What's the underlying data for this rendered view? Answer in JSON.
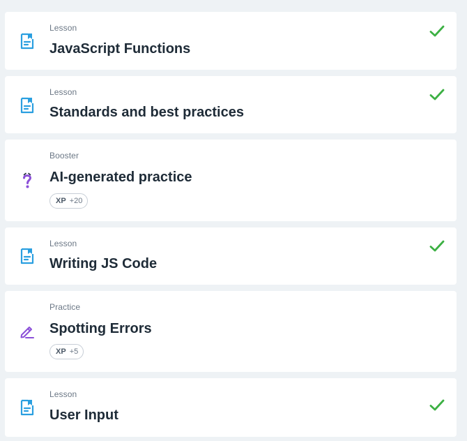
{
  "items": [
    {
      "type": "Lesson",
      "title": "JavaScript Functions",
      "icon": "lesson-icon",
      "completed": true
    },
    {
      "type": "Lesson",
      "title": "Standards and best practices",
      "icon": "lesson-icon",
      "completed": true
    },
    {
      "type": "Booster",
      "title": "AI-generated practice",
      "icon": "question-mark-icon",
      "xp_label": "XP",
      "xp_value": "+20",
      "completed": false
    },
    {
      "type": "Lesson",
      "title": "Writing JS Code",
      "icon": "lesson-icon",
      "completed": true
    },
    {
      "type": "Practice",
      "title": "Spotting Errors",
      "icon": "pencil-icon",
      "xp_label": "XP",
      "xp_value": "+5",
      "completed": false
    },
    {
      "type": "Lesson",
      "title": "User Input",
      "icon": "lesson-icon",
      "completed": true
    }
  ],
  "colors": {
    "background": "#eef2f5",
    "lesson_icon": "#2a9fe0",
    "check": "#3cb043",
    "booster_icon": "#8b4fd8",
    "practice_icon": "#8b4fd8"
  }
}
